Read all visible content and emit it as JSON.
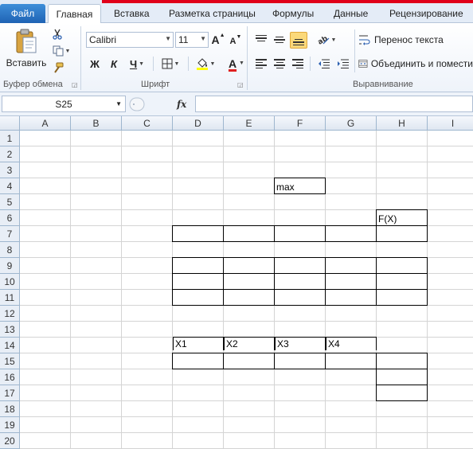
{
  "tabs": {
    "file": "Файл",
    "home": "Главная",
    "insert": "Вставка",
    "page_layout": "Разметка страницы",
    "formulas": "Формулы",
    "data": "Данные",
    "review": "Рецензирование"
  },
  "clipboard": {
    "paste_label": "Вставить",
    "group_label": "Буфер обмена"
  },
  "font": {
    "name": "Calibri",
    "size": "11",
    "group_label": "Шрифт",
    "bold": "Ж",
    "italic": "К",
    "underline": "Ч",
    "grow": "A",
    "shrink": "A",
    "font_color_glyph": "A",
    "font_color": "#e02020"
  },
  "alignment": {
    "wrap_text": "Перенос текста",
    "merge_center": "Объединить и помести",
    "group_label": "Выравнивание"
  },
  "formula_bar": {
    "name_box": "S25",
    "fx": "fx",
    "value": ""
  },
  "columns": [
    "A",
    "B",
    "C",
    "D",
    "E",
    "F",
    "G",
    "H",
    "I"
  ],
  "rows": [
    "1",
    "2",
    "3",
    "4",
    "5",
    "6",
    "7",
    "8",
    "9",
    "10",
    "11",
    "12",
    "13",
    "14",
    "15",
    "16",
    "17",
    "18",
    "19",
    "20"
  ],
  "cells": {
    "F4": "max",
    "H6": "F(X)",
    "D14": "X1",
    "E14": "X2",
    "F14": "X3",
    "G14": "X4"
  },
  "colors": {
    "accent_red": "#e0001a",
    "file_tab": "#2a72c6"
  }
}
